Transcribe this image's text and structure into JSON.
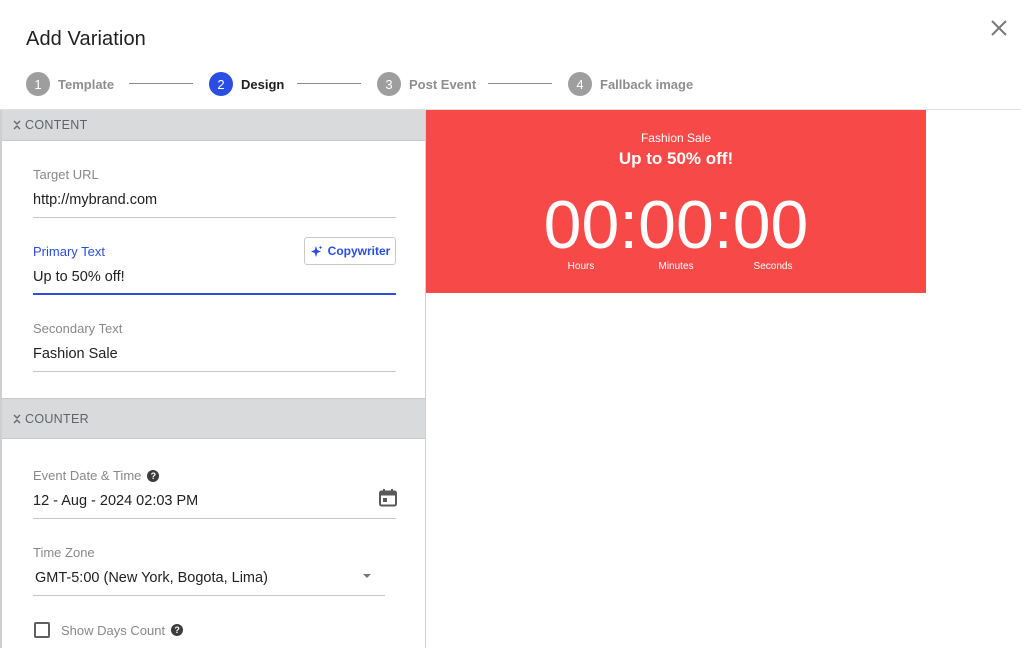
{
  "dialog": {
    "title": "Add Variation"
  },
  "steps": [
    {
      "number": "1",
      "label": "Template",
      "active": false
    },
    {
      "number": "2",
      "label": "Design",
      "active": true
    },
    {
      "number": "3",
      "label": "Post Event",
      "active": false
    },
    {
      "number": "4",
      "label": "Fallback image",
      "active": false
    }
  ],
  "content_section": {
    "header": "CONTENT",
    "target_url": {
      "label": "Target URL",
      "value": "http://mybrand.com"
    },
    "primary_text": {
      "label": "Primary Text",
      "value": "Up to 50% off!"
    },
    "copywriter_label": "Copywriter",
    "secondary_text": {
      "label": "Secondary Text",
      "value": "Fashion Sale"
    }
  },
  "counter_section": {
    "header": "COUNTER",
    "event_date": {
      "label": "Event Date & Time",
      "value": "12 - Aug - 2024 02:03 PM"
    },
    "time_zone": {
      "label": "Time Zone",
      "value": "GMT-5:00 (New York, Bogota, Lima)"
    },
    "show_days_label": "Show Days Count",
    "help_glyph": "?"
  },
  "preview": {
    "secondary": "Fashion Sale",
    "primary": "Up to 50% off!",
    "timer": "00:00:00",
    "units": [
      "Hours",
      "Minutes",
      "Seconds"
    ],
    "background_color": "#f84949"
  },
  "colors": {
    "accent": "#2a4de3",
    "inactive_step": "#9e9e9e",
    "section_header_bg": "#d9dadc"
  }
}
